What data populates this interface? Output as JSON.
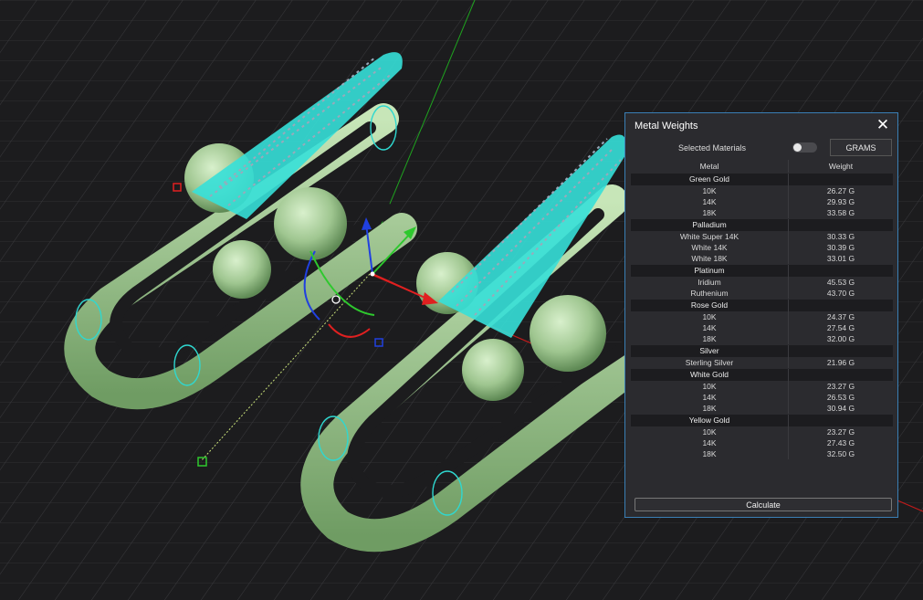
{
  "panel": {
    "title": "Metal Weights",
    "close_icon": "close-icon",
    "selected_materials_label": "Selected Materials",
    "toggle_on": false,
    "units_button": "GRAMS",
    "columns": {
      "metal": "Metal",
      "weight": "Weight"
    },
    "groups": [
      {
        "name": "Green Gold",
        "items": [
          {
            "name": "10K",
            "weight": "26.27 G"
          },
          {
            "name": "14K",
            "weight": "29.93 G"
          },
          {
            "name": "18K",
            "weight": "33.58 G"
          }
        ]
      },
      {
        "name": "Palladium",
        "items": [
          {
            "name": "White Super 14K",
            "weight": "30.33 G"
          },
          {
            "name": "White 14K",
            "weight": "30.39 G"
          },
          {
            "name": "White 18K",
            "weight": "33.01 G"
          }
        ]
      },
      {
        "name": "Platinum",
        "items": [
          {
            "name": "Iridium",
            "weight": "45.53 G"
          },
          {
            "name": "Ruthenium",
            "weight": "43.70 G"
          }
        ]
      },
      {
        "name": "Rose Gold",
        "items": [
          {
            "name": "10K",
            "weight": "24.37 G"
          },
          {
            "name": "14K",
            "weight": "27.54 G"
          },
          {
            "name": "18K",
            "weight": "32.00 G"
          }
        ]
      },
      {
        "name": "Silver",
        "items": [
          {
            "name": "Sterling Silver",
            "weight": "21.96 G"
          }
        ]
      },
      {
        "name": "White Gold",
        "items": [
          {
            "name": "10K",
            "weight": "23.27 G"
          },
          {
            "name": "14K",
            "weight": "26.53 G"
          },
          {
            "name": "18K",
            "weight": "30.94 G"
          }
        ]
      },
      {
        "name": "Yellow Gold",
        "items": [
          {
            "name": "10K",
            "weight": "23.27 G"
          },
          {
            "name": "14K",
            "weight": "27.43 G"
          },
          {
            "name": "18K",
            "weight": "32.50 G"
          }
        ]
      }
    ],
    "calculate_button": "Calculate"
  },
  "viewport": {
    "background": "#1c1c1e",
    "model_color": "#a9cf9b",
    "selection_color": "#36e0d8",
    "axis_colors": {
      "x": "#e02020",
      "y": "#20c020",
      "z": "#2040e0"
    }
  }
}
